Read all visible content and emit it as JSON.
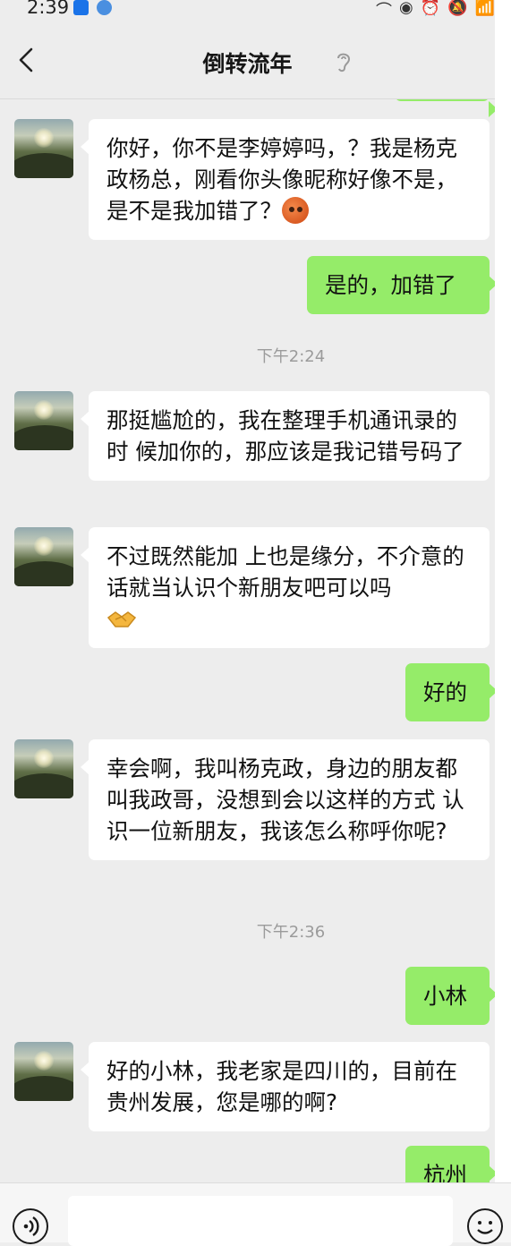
{
  "status_bar": {
    "time": "2:39",
    "icons": [
      "bluetooth-app-icon",
      "browser-app-icon",
      "data-icon",
      "eye-icon",
      "alarm-icon",
      "mute-icon",
      "wifi-icon",
      "signal-icon"
    ]
  },
  "header": {
    "title": "倒转流年",
    "back_icon": "chevron-left-icon",
    "ear_icon": "ear-icon"
  },
  "messages": [
    {
      "type": "in",
      "text": "你好，你不是李婷婷吗，？我是杨克政杨总，刚看你头像昵称好像不是，是不是我加错了？",
      "emoji": "sweat-face"
    },
    {
      "type": "out",
      "text": "是的，加错了"
    },
    {
      "type": "time",
      "text": "下午2:24"
    },
    {
      "type": "in",
      "text": "那挺尴尬的，我在整理手机通讯录的时 候加你的，那应该是我记错号码了"
    },
    {
      "type": "in",
      "text": "不过既然能加 上也是缘分，不介意的话就当认识个新朋友吧可以吗",
      "emoji": "handshake"
    },
    {
      "type": "out",
      "text": "好的"
    },
    {
      "type": "in",
      "text": "幸会啊，我叫杨克政，身边的朋友都叫我政哥，没想到会以这样的方式 认识一位新朋友，我该怎么称呼你呢?"
    },
    {
      "type": "time",
      "text": "下午2:36"
    },
    {
      "type": "out",
      "text": "小林"
    },
    {
      "type": "in",
      "text": "好的小林，我老家是四川的，目前在贵州发展，您是哪的啊?"
    },
    {
      "type": "out",
      "text": "杭州"
    }
  ],
  "colors": {
    "background": "#ededed",
    "incoming_bubble": "#ffffff",
    "outgoing_bubble": "#95ec69",
    "timestamp": "#9b9b9b"
  }
}
